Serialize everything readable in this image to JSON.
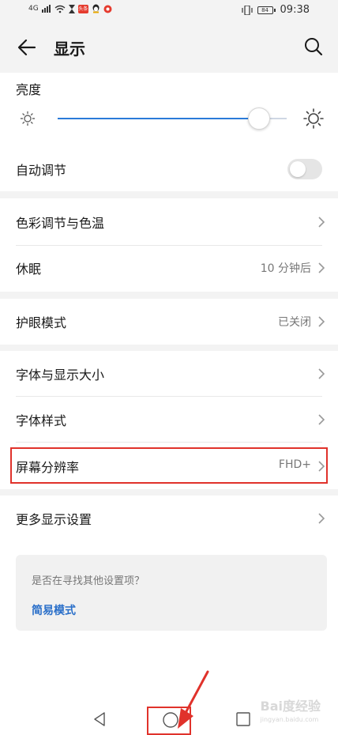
{
  "statusbar": {
    "network": "4G",
    "app_badge": "头条",
    "time": "09:38",
    "battery": "84"
  },
  "header": {
    "title": "显示",
    "back_icon": "arrow-left-icon",
    "search_icon": "search-icon"
  },
  "brightness": {
    "title": "亮度",
    "level": 0.88,
    "auto_label": "自动调节",
    "auto_enabled": false
  },
  "color_group": [
    {
      "label": "色彩调节与色温",
      "value": ""
    },
    {
      "label": "休眠",
      "value": "10 分钟后"
    }
  ],
  "eye_group": [
    {
      "label": "护眼模式",
      "value": "已关闭"
    }
  ],
  "font_group": [
    {
      "label": "字体与显示大小",
      "value": ""
    },
    {
      "label": "字体样式",
      "value": ""
    },
    {
      "label": "屏幕分辨率",
      "value": "FHD+"
    }
  ],
  "more": {
    "label": "更多显示设置"
  },
  "suggestion": {
    "question": "是否在寻找其他设置项？",
    "link": "简易模式"
  },
  "watermark": {
    "brand": "Bai度经验",
    "url": "jingyan.baidu.com"
  },
  "colors": {
    "accent": "#2a7bd9",
    "highlight": "#e0322b",
    "link": "#2a6fc9"
  }
}
